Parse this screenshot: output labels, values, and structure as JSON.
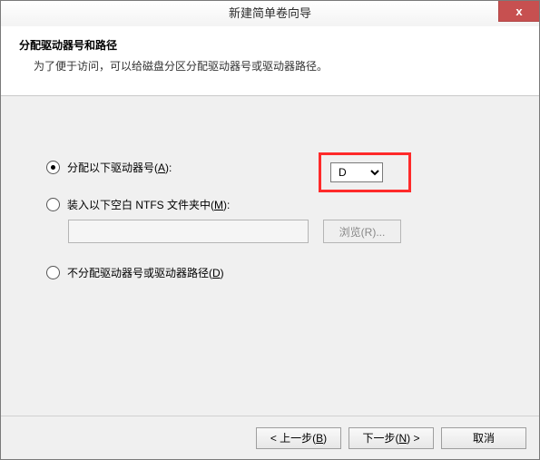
{
  "window": {
    "title": "新建简单卷向导",
    "close_glyph": "x"
  },
  "header": {
    "heading": "分配驱动器号和路径",
    "subheading": "为了便于访问，可以给磁盘分区分配驱动器号或驱动器路径。"
  },
  "options": {
    "assign_letter": {
      "prefix": "分配以下驱动器号(",
      "accel": "A",
      "suffix": "):",
      "selected": true
    },
    "drive_letter": {
      "value": "D"
    },
    "mount_folder": {
      "prefix": "装入以下空白 NTFS 文件夹中(",
      "accel": "M",
      "suffix": "):",
      "selected": false
    },
    "browse": {
      "prefix": "浏览(",
      "accel": "R",
      "suffix": ")..."
    },
    "no_assign": {
      "prefix": "不分配驱动器号或驱动器路径(",
      "accel": "D",
      "suffix": ")",
      "selected": false
    }
  },
  "footer": {
    "back": {
      "prefix": "< 上一步(",
      "accel": "B",
      "suffix": ")"
    },
    "next": {
      "prefix": "下一步(",
      "accel": "N",
      "suffix": ") >"
    },
    "cancel": {
      "label": "取消"
    }
  }
}
